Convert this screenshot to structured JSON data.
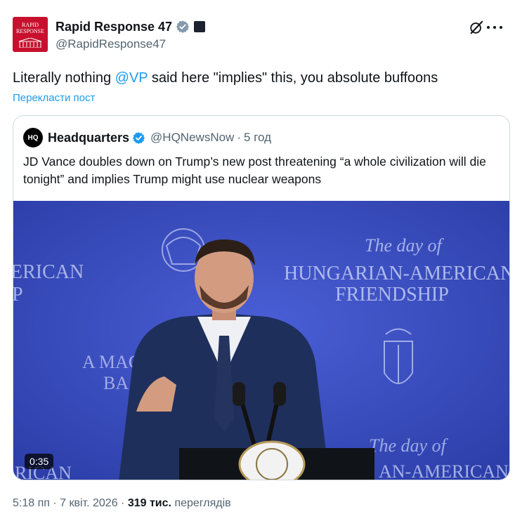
{
  "author": {
    "display_name": "Rapid Response 47",
    "handle": "@RapidResponse47",
    "avatar_text_top": "RAPID",
    "avatar_text_bottom": "RESPONSE",
    "verified_color": "#829aab",
    "avatar_color": "#c8102e"
  },
  "tweet": {
    "text_before": "Literally nothing ",
    "mention": "@VP",
    "text_after": " said here \"implies\" this, you absolute buffoons",
    "translate_label": "Перекласти пост"
  },
  "quote": {
    "avatar_text": "HQ",
    "display_name": "Headquarters",
    "handle": "@HQNewsNow",
    "separator": "·",
    "time": "5 год",
    "text": "JD Vance doubles down on Trump’s new post threatening “a whole civilization will die tonight” and implies Trump might use nuclear weapons",
    "verified_color": "#1d9bf0"
  },
  "video": {
    "duration": "0:35",
    "backdrop_script_top": "The day of",
    "backdrop_line1": "HUNGARIAN-AMERICAN",
    "backdrop_line2": "FRIENDSHIP",
    "backdrop_left1": "ERICAN",
    "backdrop_left2": "P",
    "backdrop_left3": "A MAG",
    "backdrop_left4": "BA",
    "backdrop_left_small": "B",
    "backdrop_script_bottom": "The day of",
    "backdrop_bottom_right": "AN-AMERICAN",
    "backdrop_bottom_left": "RICAN",
    "backdrop_color": "#3a4fc4"
  },
  "meta": {
    "time": "5:18 пп",
    "separator1": "·",
    "date": "7 квіт. 2026",
    "separator2": "·",
    "views_count": "319 тис.",
    "views_label": "переглядів"
  },
  "icons": {
    "grok": "grok-icon",
    "more": "more-icon",
    "verified": "verified-badge-icon",
    "affiliate": "affiliate-badge-icon"
  }
}
